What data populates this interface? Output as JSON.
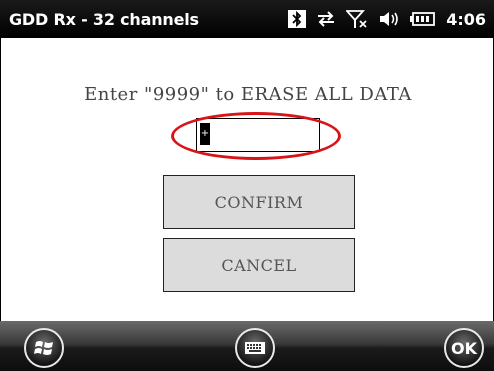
{
  "app": {
    "title": "GDD Rx - 32 channels"
  },
  "status_bar": {
    "time": "4:06",
    "icons": [
      "bluetooth-icon",
      "data-sync-icon",
      "signal-off-icon",
      "volume-icon",
      "battery-icon"
    ]
  },
  "dialog": {
    "prompt": "Enter \"9999\" to ERASE ALL DATA",
    "code_input_value": "",
    "confirm_label": "CONFIRM",
    "cancel_label": "CANCEL",
    "highlight_color": "#d81418"
  },
  "taskbar": {
    "ok_label": "OK",
    "icons": [
      "windows-start-icon",
      "keyboard-icon"
    ]
  }
}
